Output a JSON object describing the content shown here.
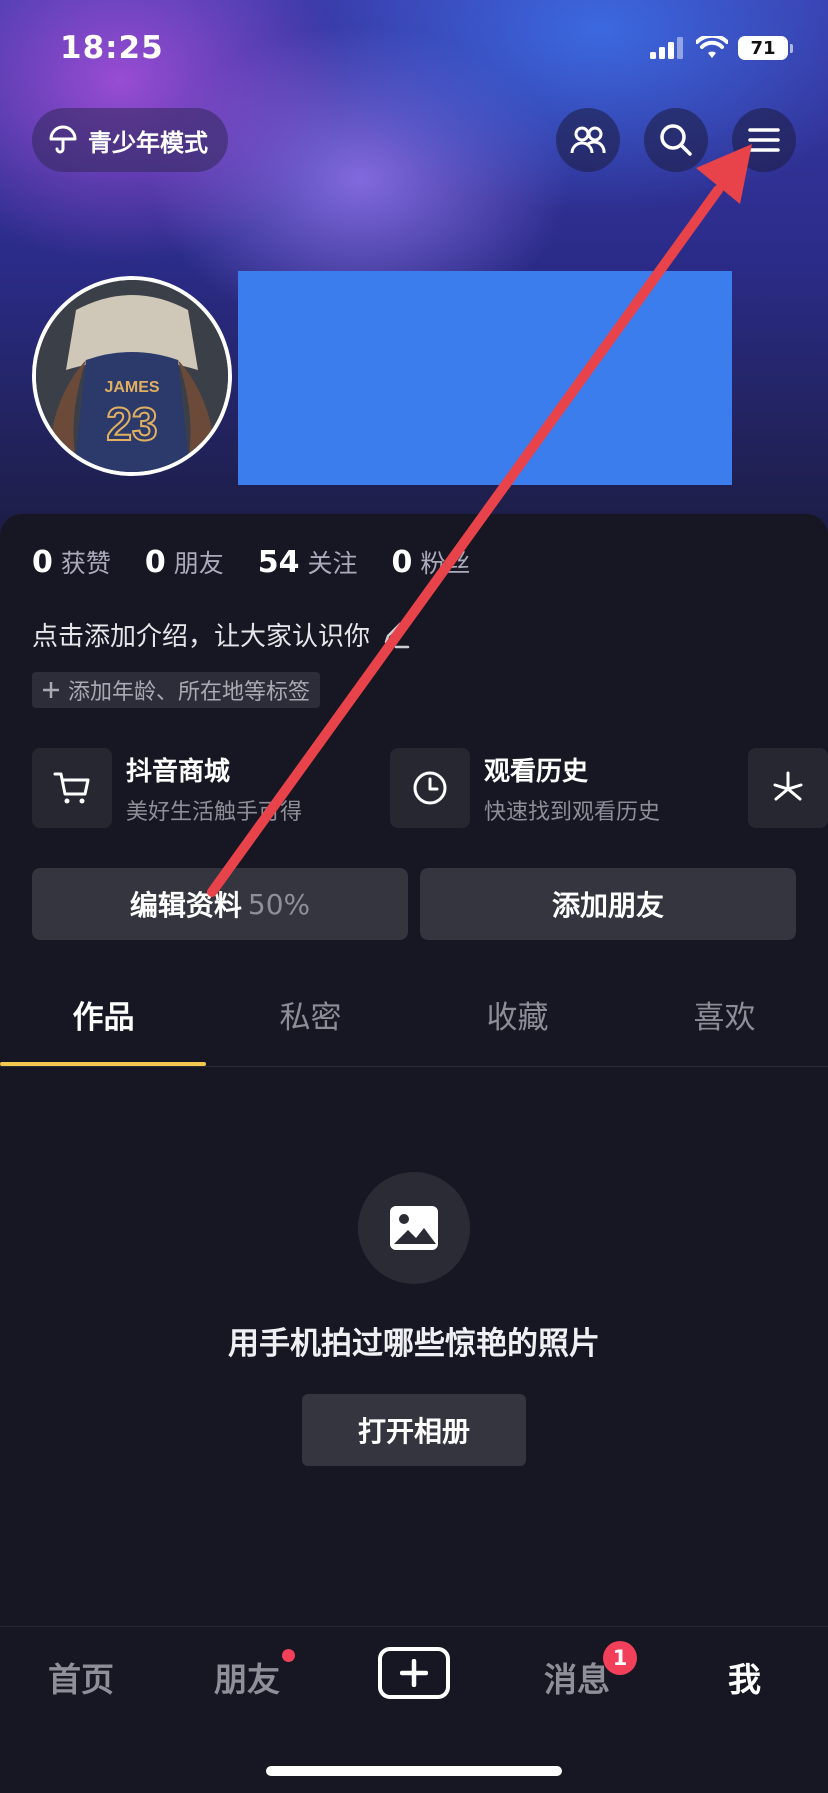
{
  "status_bar": {
    "time": "18:25",
    "battery": "71"
  },
  "header": {
    "teen_mode_label": "青少年模式"
  },
  "stats": [
    {
      "value": "0",
      "label": "获赞"
    },
    {
      "value": "0",
      "label": "朋友"
    },
    {
      "value": "54",
      "label": "关注"
    },
    {
      "value": "0",
      "label": "粉丝"
    }
  ],
  "intro_text": "点击添加介绍，让大家认识你",
  "tag_text": "添加年龄、所在地等标签",
  "services": [
    {
      "title": "抖音商城",
      "subtitle": "美好生活触手可得",
      "icon": "cart-icon"
    },
    {
      "title": "观看历史",
      "subtitle": "快速找到观看历史",
      "icon": "clock-icon"
    }
  ],
  "edit_profile": {
    "label": "编辑资料",
    "progress": "50%"
  },
  "add_friend_label": "添加朋友",
  "tabs": [
    "作品",
    "私密",
    "收藏",
    "喜欢"
  ],
  "empty_state": {
    "text": "用手机拍过哪些惊艳的照片",
    "button": "打开相册"
  },
  "nav": {
    "home": "首页",
    "friends": "朋友",
    "messages": "消息",
    "messages_badge": "1",
    "me": "我"
  },
  "colors": {
    "accent_underline": "#f2c94c",
    "badge": "#f23f5a",
    "redaction": "#3b7ded",
    "annotation_arrow": "#e8434a"
  }
}
